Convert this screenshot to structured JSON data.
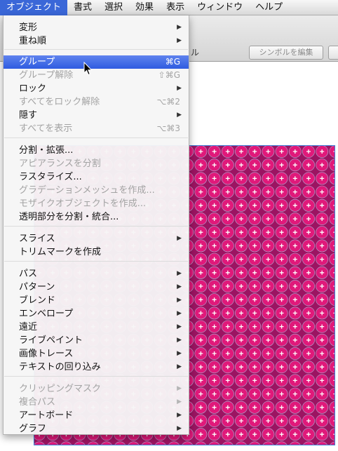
{
  "menubar": {
    "items": [
      {
        "label": "オブジェクト",
        "active": true
      },
      {
        "label": "書式"
      },
      {
        "label": "選択"
      },
      {
        "label": "効果"
      },
      {
        "label": "表示"
      },
      {
        "label": "ウィンドウ"
      },
      {
        "label": "ヘルプ"
      }
    ]
  },
  "toolbar": {
    "partial_label": "ル",
    "symbol_edit_button": "シンボルを編集"
  },
  "menu": {
    "items": [
      {
        "label": "変形",
        "submenu": true
      },
      {
        "label": "重ね順",
        "submenu": true
      },
      {
        "label": "グループ",
        "shortcut": "⌘G",
        "highlighted": true
      },
      {
        "label": "グループ解除",
        "shortcut": "⇧⌘G",
        "disabled": true
      },
      {
        "label": "ロック",
        "submenu": true
      },
      {
        "label": "すべてをロック解除",
        "shortcut": "⌥⌘2",
        "disabled": true
      },
      {
        "label": "隠す",
        "submenu": true
      },
      {
        "label": "すべてを表示",
        "shortcut": "⌥⌘3",
        "disabled": true
      },
      {
        "label": "分割・拡張..."
      },
      {
        "label": "アピアランスを分割",
        "disabled": true
      },
      {
        "label": "ラスタライズ..."
      },
      {
        "label": "グラデーションメッシュを作成...",
        "disabled": true
      },
      {
        "label": "モザイクオブジェクトを作成...",
        "disabled": true
      },
      {
        "label": "透明部分を分割・統合..."
      },
      {
        "label": "スライス",
        "submenu": true
      },
      {
        "label": "トリムマークを作成"
      },
      {
        "label": "パス",
        "submenu": true
      },
      {
        "label": "パターン",
        "submenu": true
      },
      {
        "label": "ブレンド",
        "submenu": true
      },
      {
        "label": "エンベロープ",
        "submenu": true
      },
      {
        "label": "遠近",
        "submenu": true
      },
      {
        "label": "ライブペイント",
        "submenu": true
      },
      {
        "label": "画像トレース",
        "submenu": true
      },
      {
        "label": "テキストの回り込み",
        "submenu": true
      },
      {
        "label": "クリッピングマスク",
        "submenu": true,
        "disabled": true
      },
      {
        "label": "複合パス",
        "submenu": true,
        "disabled": true
      },
      {
        "label": "アートボード",
        "submenu": true
      },
      {
        "label": "グラフ",
        "submenu": true
      }
    ],
    "arrow_glyph": "▶"
  },
  "artwork": {
    "fill_color": "#e0197a",
    "ring_color": "#9c1462",
    "selection_color": "#3e7fd6"
  }
}
